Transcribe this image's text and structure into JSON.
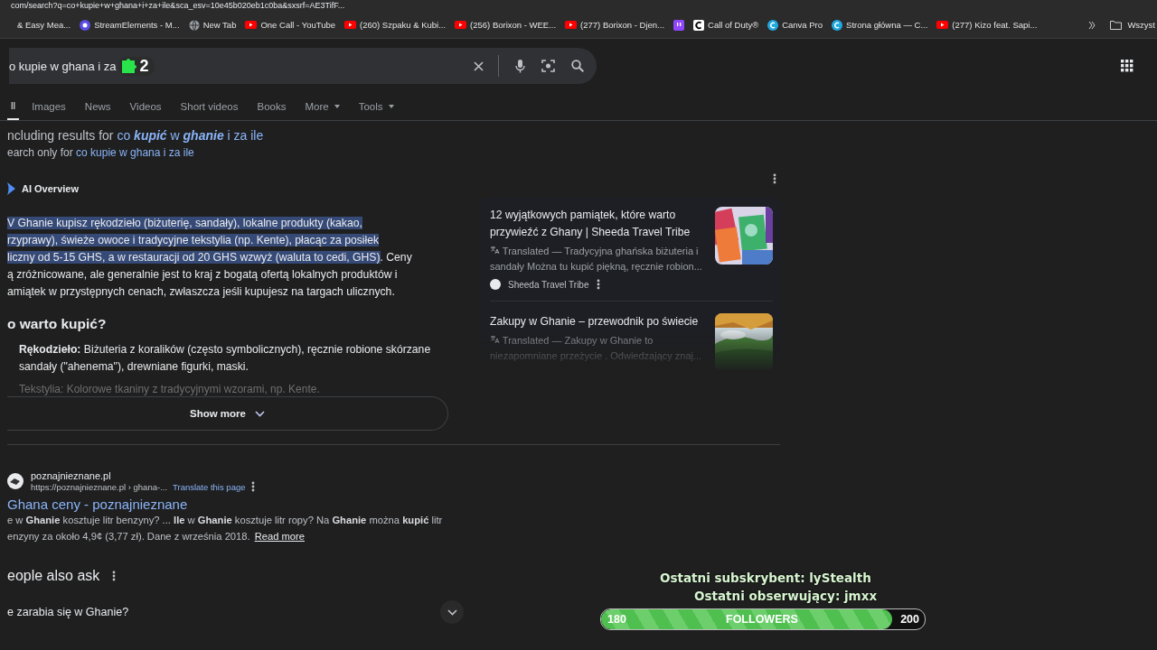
{
  "address_bar": {
    "url": "com/search?q=co+kupie+w+ghana+i+za+ile&sca_esv=10e45b020eb1c0ba&sxsrf=AE3TifF..."
  },
  "bookmarks": [
    {
      "label": "& Easy Mea...",
      "kind": "plain"
    },
    {
      "label": "StreamElements - M...",
      "kind": "stream"
    },
    {
      "label": "New Tab",
      "kind": "globe"
    },
    {
      "label": "One Call - YouTube",
      "kind": "youtube"
    },
    {
      "label": "(260) Szpaku & Kubi...",
      "kind": "youtube"
    },
    {
      "label": "(256) Borixon - WEE...",
      "kind": "youtube"
    },
    {
      "label": "(277) Borixon - Djen...",
      "kind": "youtube"
    },
    {
      "kind": "twitch"
    },
    {
      "label": "Call of Duty®",
      "kind": "cod"
    },
    {
      "label": "Canva Pro",
      "kind": "canva"
    },
    {
      "label": "Strona główna — C...",
      "kind": "canva"
    },
    {
      "label": "(277) Kizo feat. Sapi...",
      "kind": "youtube"
    }
  ],
  "bookmarks_folder": "Wszyst",
  "search": {
    "value": "o kupie w ghana i za",
    "badge": "2"
  },
  "tabs": [
    {
      "label": "ll",
      "selected": true,
      "kind": "tab"
    },
    {
      "label": "Images",
      "selected": false,
      "kind": "tab"
    },
    {
      "label": "News",
      "selected": false,
      "kind": "tab"
    },
    {
      "label": "Videos",
      "selected": false,
      "kind": "tab"
    },
    {
      "label": "Short videos",
      "selected": false,
      "kind": "tab"
    },
    {
      "label": "Books",
      "selected": false,
      "kind": "tab"
    },
    {
      "label": "More",
      "selected": false,
      "kind": "menu"
    },
    {
      "label": "Tools",
      "selected": false,
      "kind": "menu"
    }
  ],
  "spelling": {
    "including": "ncluding results for",
    "corrected": "co **kupić** w **ghanie** i za ile",
    "search_only": "earch only for",
    "original": "co kupie w ghana i za ile"
  },
  "overview": {
    "title": "AI Overview",
    "lines": [
      [
        {
          "text": "V Ghanie kupisz rękodzieło (biżuterię, sandały), lokalne produkty (kakao,",
          "selected": true
        }
      ],
      [
        {
          "text": "rzyprawy), świeże owoce i tradycyjne tekstylia (np. Kente), płacąc za posiłek",
          "selected": true
        }
      ],
      [
        {
          "text": "liczny od 5-15 GHS, a w restauracji od 20 GHS wzwyż (waluta to cedi, GHS)",
          "selected": true
        },
        {
          "text": ". Ceny",
          "selected": false
        }
      ],
      [
        {
          "text": "ą zróżnicowane, ale generalnie jest to kraj z bogatą ofertą lokalnych produktów i",
          "selected": false
        }
      ],
      [
        {
          "text": "amiątek w przystępnych cenach, zwłaszcza jeśli kupujesz na targach ulicznych.",
          "selected": false
        }
      ]
    ],
    "heading": "o warto kupić?",
    "item": "**Rękodzieło:** Biżuteria z koralików (często symbolicznych), ręcznie robione skórzane sandały (\"ahenema\"), drewniane figurki, maski.",
    "faded_item": "Tekstylia: Kolorowe tkaniny z tradycyjnymi wzorami, np. Kente.",
    "show_more": "Show more",
    "sources": [
      {
        "title": "12 wyjątkowych pamiątek, które warto przywieźć z Ghany | Sheeda Travel Tribe",
        "snippet": "Translated — Tradycyjna ghańska biżuteria i sandały Można tu kupić piękną, ręcznie robion...",
        "site": "Sheeda Travel Tribe",
        "kind": "books"
      },
      {
        "title": "Zakupy w Ghanie – przewodnik po świecie",
        "snippet": "Translated — Zakupy w Ghanie to niezapomniane przeżycie . Odwiedzający znaj...",
        "kind": "landscape"
      }
    ]
  },
  "result": {
    "site": "poznajnieznane.pl",
    "url": "https://poznajnieznane.pl › ghana-...",
    "translate": "Translate this page",
    "title": "Ghana ceny - poznajnieznane",
    "lines": [
      "e w **Ghanie** kosztuje litr benzyny? ... **Ile** w **Ghanie** kosztuje litr ropy? Na **Ghanie** można **kupić** litr",
      "enzyny za około 4,9¢ (3,77 zł). Dane z września 2018."
    ],
    "read_more": "Read more"
  },
  "people_also_ask": {
    "title": "eople also ask",
    "question": "e zarabia się w Ghanie?"
  },
  "stream_overlay": {
    "subscriber": "Ostatni subskrybent: lyStealth",
    "follower": "Ostatni obserwujący: jmxx",
    "bar_label": "FOLLOWERS",
    "start": "180",
    "goal": "200",
    "level": 0.9
  }
}
